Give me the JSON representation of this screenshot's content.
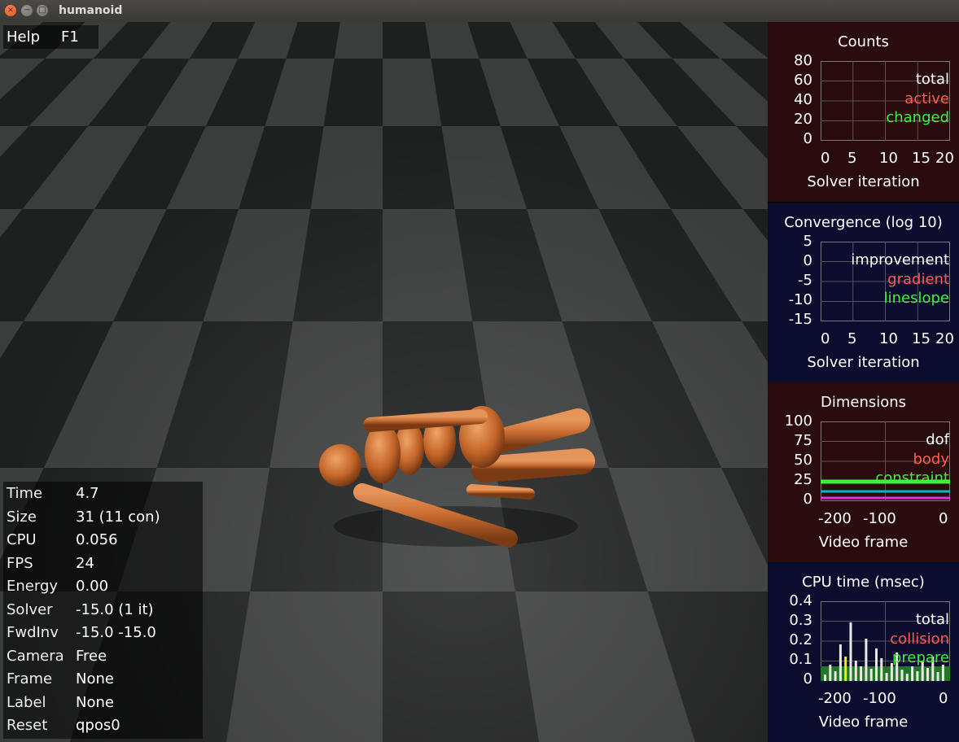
{
  "window": {
    "title": "humanoid"
  },
  "help": {
    "key": "Help",
    "value": "F1"
  },
  "info": [
    {
      "key": "Time",
      "value": "4.7"
    },
    {
      "key": "Size",
      "value": "31  (11 con)"
    },
    {
      "key": "CPU",
      "value": "0.056"
    },
    {
      "key": "FPS",
      "value": "24"
    },
    {
      "key": "Energy",
      "value": "0.00"
    },
    {
      "key": "Solver",
      "value": "-15.0  (1 it)"
    },
    {
      "key": "FwdInv",
      "value": "-15.0 -15.0"
    },
    {
      "key": "Camera",
      "value": "Free"
    },
    {
      "key": "Frame",
      "value": "None"
    },
    {
      "key": "Label",
      "value": "None"
    },
    {
      "key": "Reset",
      "value": "qpos0"
    }
  ],
  "colors": {
    "white": "#ffffff",
    "red": "#ff5a50",
    "green": "#3cf03c"
  },
  "panels": [
    {
      "title": "Counts",
      "bg": "#2a0c0c",
      "yticks": [
        "80",
        "60",
        "40",
        "20",
        "0"
      ],
      "xticks": [
        "0",
        "5",
        "10",
        "15",
        "20"
      ],
      "xtitle": "Solver iteration",
      "legend": [
        {
          "label": "total",
          "color": "#ffffff"
        },
        {
          "label": "active",
          "color": "#ff5a50"
        },
        {
          "label": "changed",
          "color": "#3cf03c"
        }
      ]
    },
    {
      "title": "Convergence (log 10)",
      "bg": "#0c0c2e",
      "yticks": [
        "5",
        "0",
        "-5",
        "-10",
        "-15"
      ],
      "xticks": [
        "0",
        "5",
        "10",
        "15",
        "20"
      ],
      "xtitle": "Solver iteration",
      "legend": [
        {
          "label": "improvement",
          "color": "#ffffff"
        },
        {
          "label": "gradient",
          "color": "#ff5a50"
        },
        {
          "label": "lineslope",
          "color": "#3cf03c"
        }
      ]
    },
    {
      "title": "Dimensions",
      "bg": "#2a0c0c",
      "yticks": [
        "100",
        "75",
        "50",
        "25",
        "0"
      ],
      "xticks": [
        "-200",
        "-100",
        "0"
      ],
      "xtitle": "Video frame",
      "legend": [
        {
          "label": "dof",
          "color": "#ffffff"
        },
        {
          "label": "body",
          "color": "#ff5a50"
        },
        {
          "label": "constraint",
          "color": "#3cf03c"
        }
      ]
    },
    {
      "title": "CPU time (msec)",
      "bg": "#0c0c2e",
      "yticks": [
        "0.4",
        "0.3",
        "0.2",
        "0.1",
        "0"
      ],
      "xticks": [
        "-200",
        "-100",
        "0"
      ],
      "xtitle": "Video frame",
      "legend": [
        {
          "label": "total",
          "color": "#ffffff"
        },
        {
          "label": "collision",
          "color": "#ff5a50"
        },
        {
          "label": "prepare",
          "color": "#3cf03c"
        }
      ]
    }
  ]
}
